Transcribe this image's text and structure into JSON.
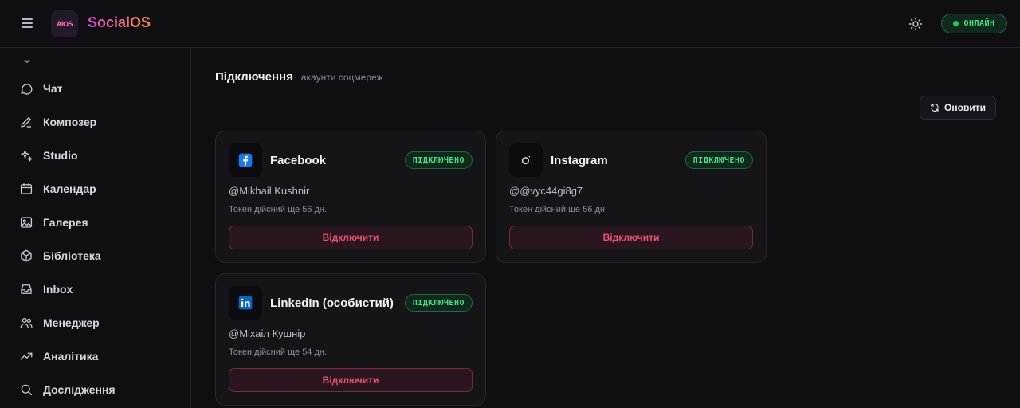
{
  "header": {
    "logo_text": "AIOS",
    "brand": "SocialOS",
    "status_label": "ОНЛАЙН"
  },
  "sidebar": {
    "items": [
      {
        "label": "Чат",
        "icon": "chat-icon"
      },
      {
        "label": "Композер",
        "icon": "pen-icon"
      },
      {
        "label": "Studio",
        "icon": "sparkles-icon"
      },
      {
        "label": "Календар",
        "icon": "calendar-icon"
      },
      {
        "label": "Галерея",
        "icon": "image-icon"
      },
      {
        "label": "Бібліотека",
        "icon": "box-icon"
      },
      {
        "label": "Inbox",
        "icon": "inbox-icon"
      },
      {
        "label": "Менеджер",
        "icon": "users-icon"
      },
      {
        "label": "Аналітика",
        "icon": "trending-icon"
      },
      {
        "label": "Дослідження",
        "icon": "search-icon"
      }
    ]
  },
  "main": {
    "title": "Підключення",
    "subtitle": "акаунти соцмереж",
    "refresh_label": "Оновити",
    "cards": [
      {
        "network": "Facebook",
        "icon": "facebook-icon",
        "status": "ПІДКЛЮЧЕНО",
        "handle": "@Mikhail Kushnir",
        "token": "Токен дійсний ще 56 дн.",
        "action": "Відключити"
      },
      {
        "network": "Instagram",
        "icon": "instagram-icon",
        "status": "ПІДКЛЮЧЕНО",
        "handle": "@@vyc44gi8g7",
        "token": "Токен дійсний ще 56 дн.",
        "action": "Відключити"
      },
      {
        "network": "LinkedIn (особистий)",
        "icon": "linkedin-icon",
        "status": "ПІДКЛЮЧЕНО",
        "handle": "@Міхаіл Кушнір",
        "token": "Токен дійсний ще 54 дн.",
        "action": "Відключити"
      }
    ]
  },
  "colors": {
    "background": "#0e0e13",
    "card": "#141419",
    "success": "#4ade80",
    "danger": "#f0506e",
    "brand_from": "#d74ad0",
    "brand_to": "#ff8a3d"
  }
}
